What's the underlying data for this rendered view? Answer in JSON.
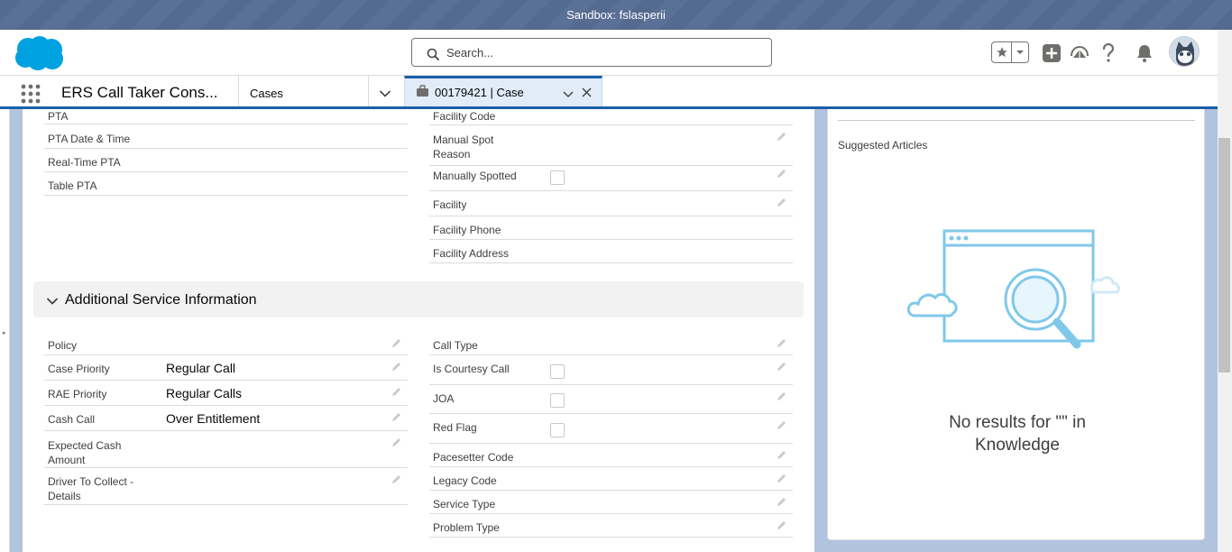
{
  "sandbox": {
    "label": "Sandbox: fslasperii"
  },
  "header": {
    "search_placeholder": "Search...",
    "brand_color": "#00a1e0",
    "icons": [
      "favorites-star-icon",
      "add-icon",
      "trailhead-icon",
      "help-icon",
      "notification-bell-icon",
      "avatar"
    ]
  },
  "nav": {
    "app_name": "ERS Call Taker Cons...",
    "object_tab": "Cases",
    "record_tab": "00179421 | Case"
  },
  "top_left_fields": [
    {
      "label": "PTA"
    },
    {
      "label": "PTA Date & Time"
    },
    {
      "label": "Real-Time PTA"
    },
    {
      "label": "Table PTA"
    }
  ],
  "top_right_fields": [
    {
      "label": "Facility Code"
    },
    {
      "label": "Manual Spot Reason"
    },
    {
      "label": "Manually Spotted"
    },
    {
      "label": "Facility"
    },
    {
      "label": "Facility Phone"
    },
    {
      "label": "Facility Address"
    }
  ],
  "section": {
    "title": "Additional Service Information"
  },
  "asi_left": [
    {
      "label": "Policy",
      "value": ""
    },
    {
      "label": "Case Priority",
      "value": "Regular Call"
    },
    {
      "label": "RAE Priority",
      "value": "Regular Calls"
    },
    {
      "label": "Cash Call",
      "value": "Over Entitlement"
    },
    {
      "label": "Expected Cash Amount",
      "value": ""
    },
    {
      "label": "Driver To Collect - Details",
      "value": ""
    }
  ],
  "asi_right": [
    {
      "label": "Call Type"
    },
    {
      "label": "Is Courtesy Call"
    },
    {
      "label": "JOA"
    },
    {
      "label": "Red Flag"
    },
    {
      "label": "Pacesetter Code"
    },
    {
      "label": "Legacy Code"
    },
    {
      "label": "Service Type"
    },
    {
      "label": "Problem Type"
    }
  ],
  "knowledge": {
    "heading": "Suggested Articles",
    "empty_message_line1": "No results for \"\" in",
    "empty_message_line2": "Knowledge"
  }
}
